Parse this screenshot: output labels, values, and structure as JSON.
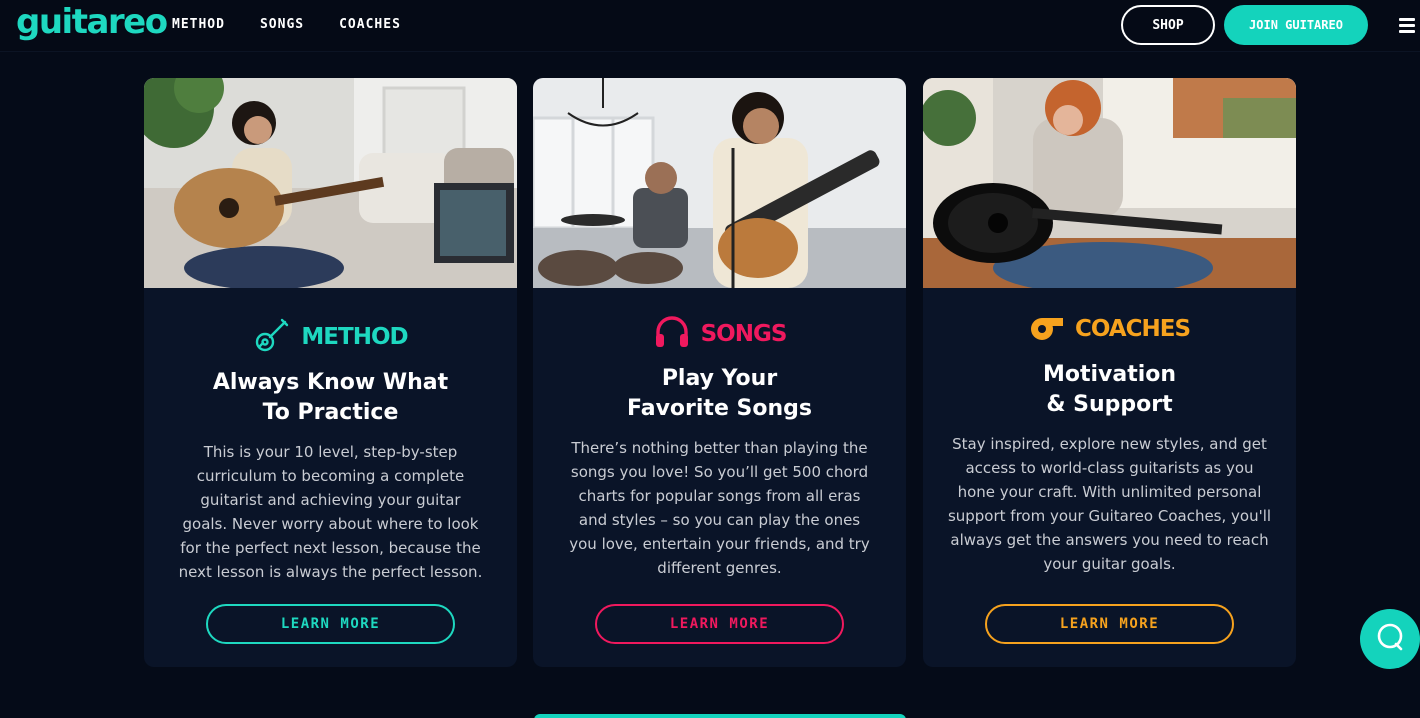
{
  "header": {
    "logo": "guitareo",
    "nav": [
      "METHOD",
      "SONGS",
      "COACHES"
    ],
    "shop_label": "SHOP",
    "join_label": "JOIN GUITAREO"
  },
  "colors": {
    "teal": "#1ed8c0",
    "pink": "#f0195e",
    "orange": "#f6a21e",
    "card_bg": "#0a1428",
    "page_bg": "#050b18"
  },
  "cards": [
    {
      "brand": "METHOD",
      "brand_icon": "guitar-icon",
      "heading": [
        "Always Know What",
        "To Practice"
      ],
      "body": "This is your 10 level, step-by-step curriculum to becoming a complete guitarist and achieving your guitar goals. Never worry about where to look for the perfect next lesson, because the next lesson is always the perfect lesson.",
      "button": "LEARN MORE"
    },
    {
      "brand": "SONGS",
      "brand_icon": "headphones-icon",
      "heading": [
        "Play Your",
        "Favorite Songs"
      ],
      "body": "There’s nothing better than playing the songs you love! So you’ll get 500 chord charts for popular songs from all eras and styles – so you can play the ones you love, entertain your friends, and try different genres.",
      "button": "LEARN MORE"
    },
    {
      "brand": "COACHES",
      "brand_icon": "whistle-icon",
      "heading": [
        "Motivation",
        "& Support"
      ],
      "body": "Stay inspired, explore new styles, and get access to world-class guitarists as you hone your craft. With unlimited personal support from your Guitareo Coaches, you'll always get the answers you need to reach your guitar goals.",
      "button": "LEARN MORE"
    }
  ],
  "chat_icon": "chat-bubble-icon"
}
